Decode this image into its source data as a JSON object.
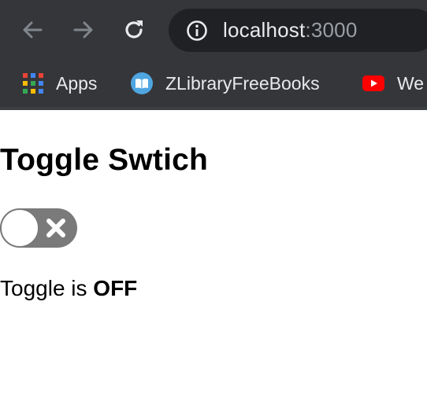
{
  "browser": {
    "url_host": "localhost",
    "url_port": ":3000",
    "bookmarks": [
      {
        "label": "Apps",
        "icon": "apps-grid-icon"
      },
      {
        "label": "ZLibraryFreeBooks",
        "icon": "book-icon"
      },
      {
        "label": "We",
        "icon": "youtube-icon"
      }
    ]
  },
  "page": {
    "title": "Toggle Swtich",
    "toggle": {
      "state": "off",
      "icon": "close-x-icon"
    },
    "status_prefix": "Toggle is ",
    "status_value": "OFF"
  },
  "colors": {
    "chrome_bg": "#35363a",
    "omnibox_bg": "#202124",
    "toggle_track": "#7a7a7a",
    "youtube_red": "#ff0000",
    "book_blue": "#4fa6e0"
  }
}
